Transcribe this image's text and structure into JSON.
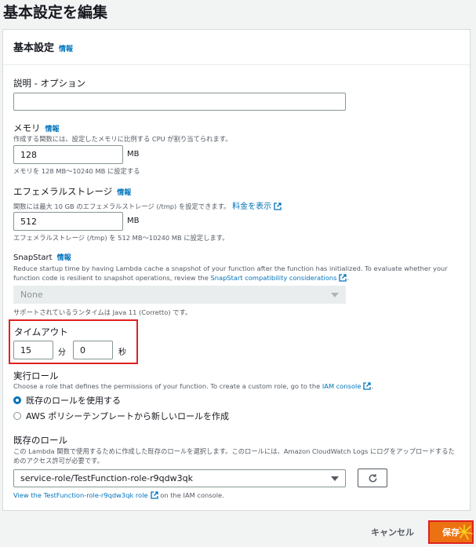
{
  "page": {
    "title": "基本設定を編集"
  },
  "panel": {
    "title": "基本設定",
    "info": "情報"
  },
  "description": {
    "label": "説明 - オプション",
    "value": ""
  },
  "memory": {
    "label": "メモリ",
    "info": "情報",
    "desc": "作成する関数には、設定したメモリに比例する CPU が割り当てられます。",
    "value": "128",
    "unit": "MB",
    "constraint": "メモリを 128 MB〜10240 MB に設定する"
  },
  "ephemeral": {
    "label": "エフェメラルストレージ",
    "info": "情報",
    "desc": "関数には最大 10 GB のエフェメラルストレージ (/tmp) を設定できます。",
    "pricing_link": "料金を表示",
    "value": "512",
    "unit": "MB",
    "constraint": "エフェメラルストレージ (/tmp) を 512 MB〜10240 MB に設定します。"
  },
  "snapstart": {
    "label": "SnapStart",
    "info": "情報",
    "desc": "Reduce startup time by having Lambda cache a snapshot of your function after the function has initialized. To evaluate whether your function code is resilient to snapshot operations, review the",
    "link": "SnapStart compatibility considerations",
    "period": ".",
    "selected": "None",
    "support": "サポートされているランタイムは Java 11 (Corretto) です。"
  },
  "timeout": {
    "label": "タイムアウト",
    "minutes": "15",
    "min_unit": "分",
    "seconds": "0",
    "sec_unit": "秒"
  },
  "role": {
    "label": "実行ロール",
    "desc": "Choose a role that defines the permissions of your function. To create a custom role, go to the",
    "link": "IAM console",
    "period": ".",
    "options": [
      {
        "label": "既存のロールを使用する",
        "checked": true
      },
      {
        "label": "AWS ポリシーテンプレートから新しいロールを作成",
        "checked": false
      }
    ]
  },
  "existing_role": {
    "label": "既存のロール",
    "desc": "この Lambda 関数で使用するために作成した既存のロールを選択します。このロールには、Amazon CloudWatch Logs にログをアップロードするためのアクセス許可が必要です。",
    "selected": "service-role/TestFunction-role-r9qdw3qk",
    "view_link": "View the TestFunction-role-r9qdw3qk role",
    "view_suffix": "on the IAM console."
  },
  "footer": {
    "cancel": "キャンセル",
    "save": "保存"
  },
  "colors": {
    "accent": "#0073bb",
    "primary": "#ec7211",
    "highlight": "#e02121"
  }
}
